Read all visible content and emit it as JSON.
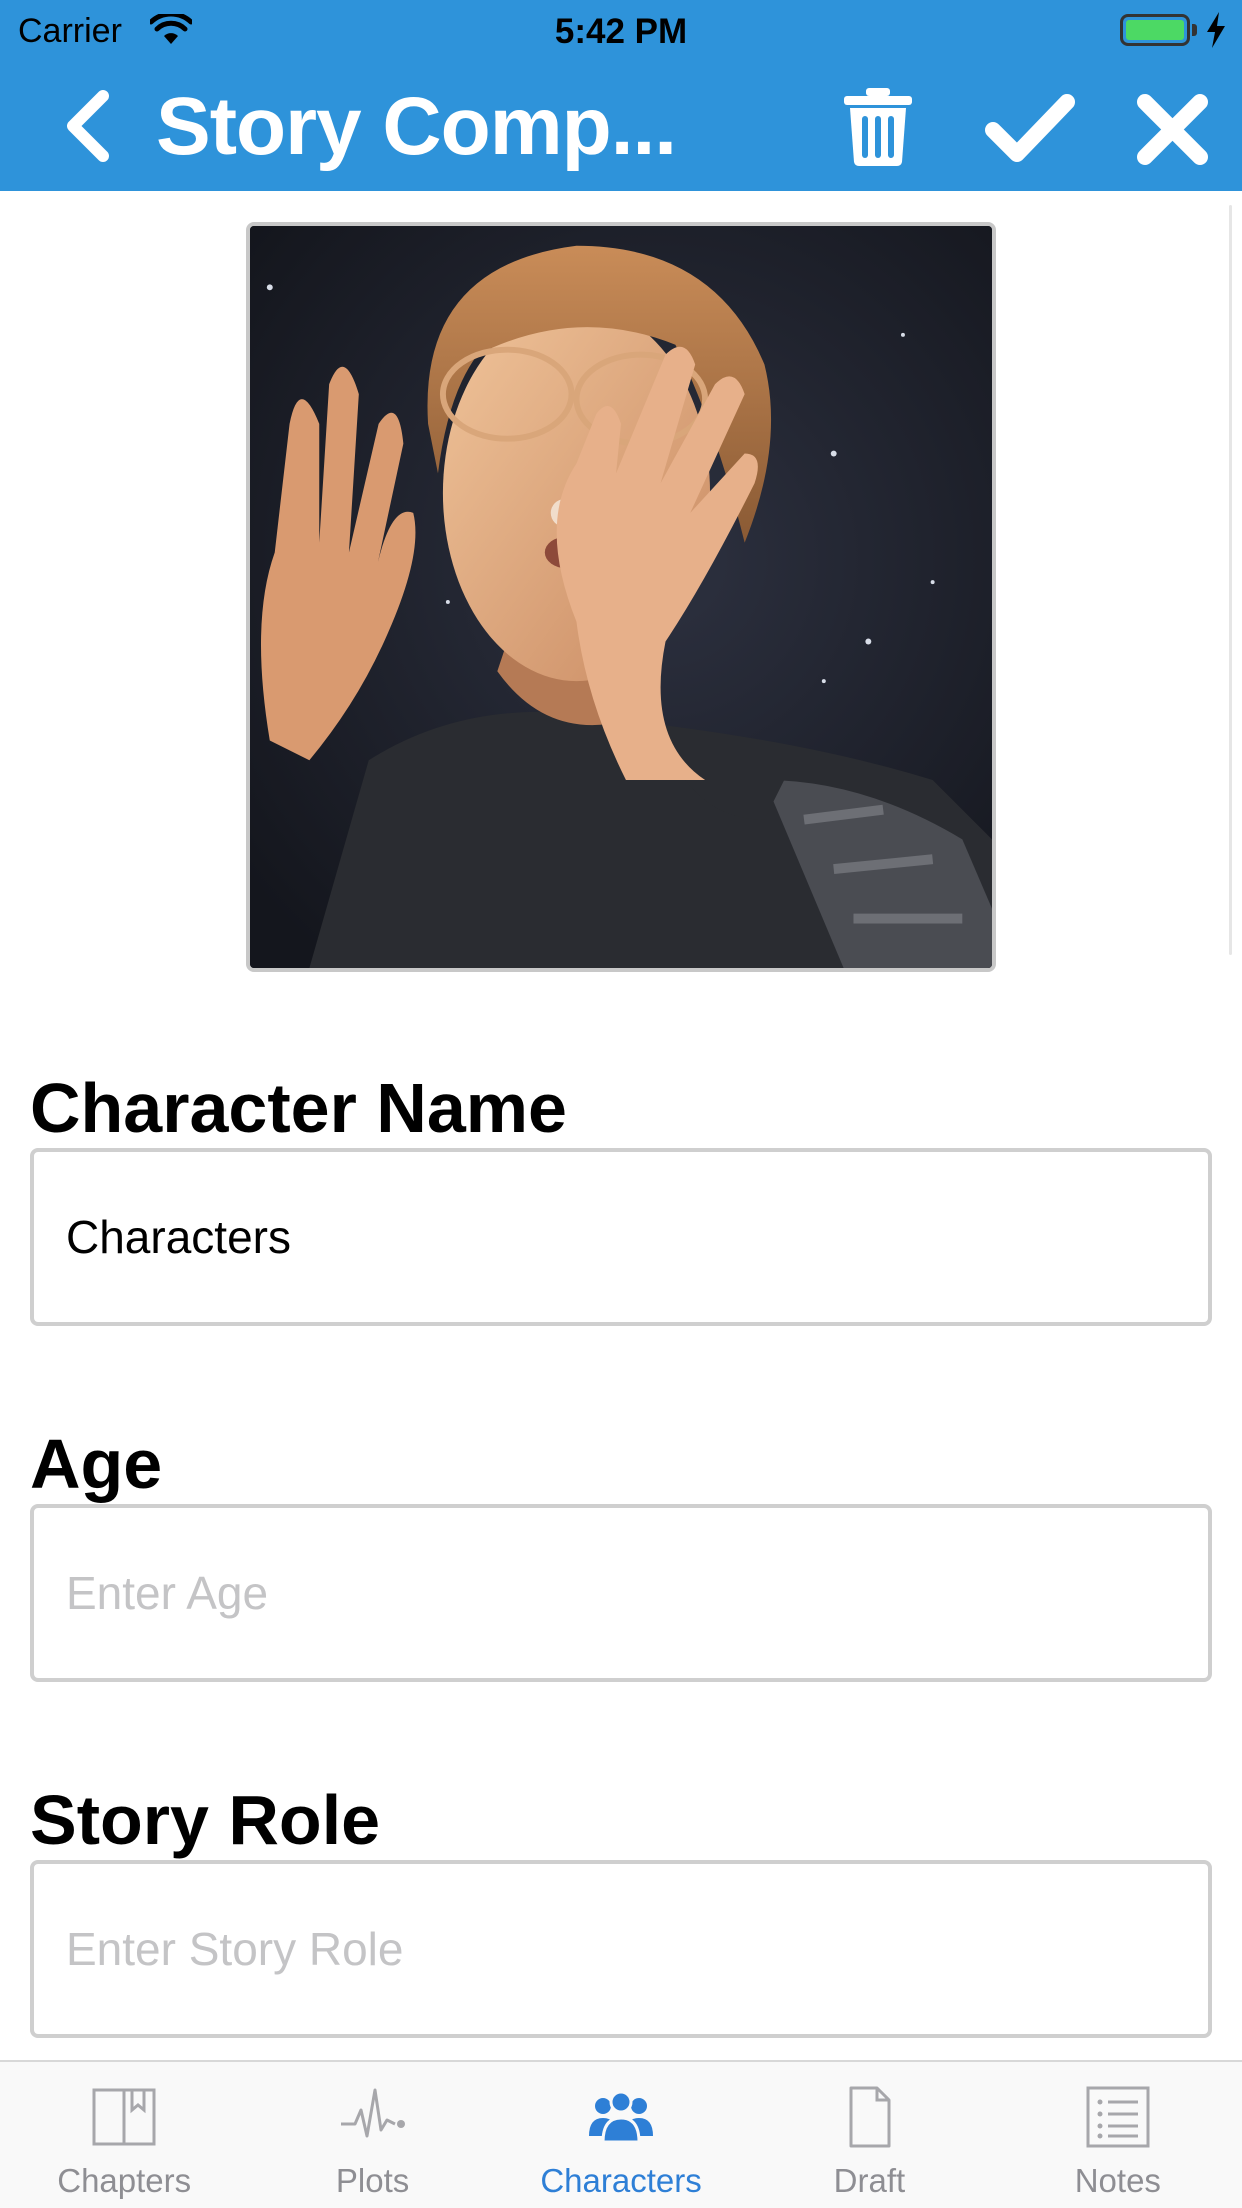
{
  "status_bar": {
    "carrier": "Carrier",
    "time": "5:42 PM",
    "battery_color": "#4cd964"
  },
  "nav_bar": {
    "title": "Story Comp...",
    "back_icon": "chevron-left-icon",
    "actions": [
      "trash-icon",
      "checkmark-icon",
      "close-icon"
    ],
    "background_color": "#2e93da"
  },
  "character_photo": {
    "icon": "character-photo"
  },
  "form": {
    "name": {
      "label": "Character Name",
      "value": "Characters",
      "placeholder": ""
    },
    "age": {
      "label": "Age",
      "value": "",
      "placeholder": "Enter Age"
    },
    "story_role": {
      "label": "Story Role",
      "value": "",
      "placeholder": "Enter Story Role"
    }
  },
  "tab_bar": {
    "active_color": "#2e7fd6",
    "tabs": [
      {
        "label": "Chapters",
        "icon": "book-icon",
        "active": false
      },
      {
        "label": "Plots",
        "icon": "pulse-icon",
        "active": false
      },
      {
        "label": "Characters",
        "icon": "people-icon",
        "active": true
      },
      {
        "label": "Draft",
        "icon": "document-icon",
        "active": false
      },
      {
        "label": "Notes",
        "icon": "list-icon",
        "active": false
      }
    ]
  }
}
